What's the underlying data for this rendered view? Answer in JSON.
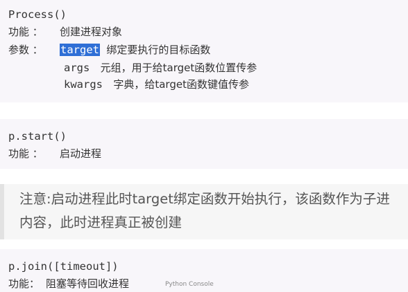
{
  "process": {
    "title": "Process()",
    "func_label": "功能 ：",
    "func_desc": "创建进程对象",
    "param_label": "参数 ：",
    "param_target": "target",
    "param_target_desc": "绑定要执行的目标函数",
    "param_args": "args",
    "param_args_desc": "元组，用于给target函数位置传参",
    "param_kwargs": "kwargs",
    "param_kwargs_desc": "字典，给target函数键值传参"
  },
  "start": {
    "title": "p.start()",
    "func_label": "功能 ：",
    "func_desc": "启动进程"
  },
  "note": {
    "line1": "注意:启动进程此时target绑定函数开始执行，该函数作为子进",
    "line2": "内容，此时进程真正被创建"
  },
  "join": {
    "title": "p.join([timeout])",
    "func_label": "功能：",
    "func_desc": "阻塞等待回收进程",
    "overlay": "Python Console"
  },
  "colors": {
    "code_bg": "#f8f6fa",
    "selection": "#2f6fd6",
    "note_border": "#e2e2e2"
  }
}
